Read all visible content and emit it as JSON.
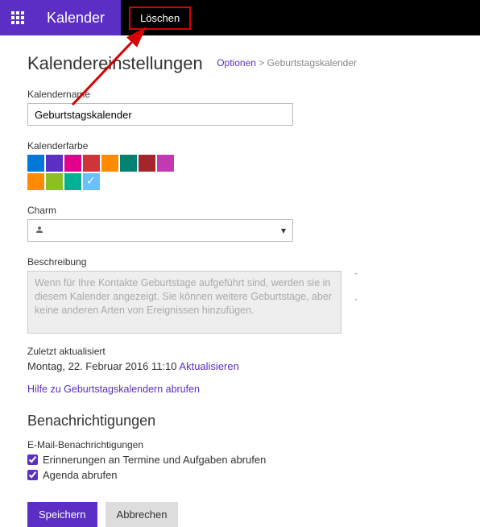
{
  "header": {
    "brand": "Kalender",
    "delete_label": "Löschen"
  },
  "page": {
    "title": "Kalendereinstellungen",
    "breadcrumb_link": "Optionen",
    "breadcrumb_sep": ">",
    "breadcrumb_current": "Geburtstagskalender"
  },
  "name_section": {
    "label": "Kalendername",
    "value": "Geburtstagskalender"
  },
  "color_section": {
    "label": "Kalenderfarbe",
    "colors": [
      "#0078d7",
      "#5b2ec4",
      "#e3008c",
      "#d13438",
      "#ff8c00",
      "#008272",
      "#a4262c",
      "#c239b3",
      "#ff8c00",
      "#8cbf26",
      "#00b294",
      "#69c0ff"
    ],
    "selected_index": 11
  },
  "charm_section": {
    "label": "Charm",
    "selected_icon": "person-icon"
  },
  "desc_section": {
    "label": "Beschreibung",
    "text": "Wenn für Ihre Kontakte Geburtstage aufgeführt sind, werden sie in diesem Kalender angezeigt. Sie können weitere Geburtstage, aber keine anderen Arten von Ereignissen hinzufügen."
  },
  "updated": {
    "label": "Zuletzt aktualisiert",
    "value": "Montag, 22. Februar 2016 11:10",
    "refresh": "Aktualisieren"
  },
  "help_link": "Hilfe zu Geburtstagskalendern abrufen",
  "notifications": {
    "title": "Benachrichtigungen",
    "email_label": "E-Mail-Benachrichtigungen",
    "opt1": "Erinnerungen an Termine und Aufgaben abrufen",
    "opt2": "Agenda abrufen"
  },
  "buttons": {
    "save": "Speichern",
    "cancel": "Abbrechen"
  }
}
